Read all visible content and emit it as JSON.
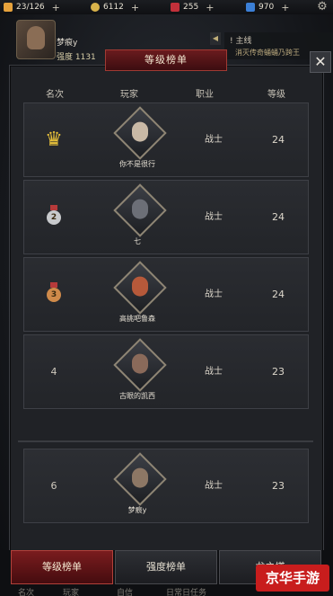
{
  "topbar": {
    "stamina": "23/126",
    "gold": "6112",
    "gems": "255",
    "crystals": "970"
  },
  "header": {
    "player_name": "梦痕y",
    "strength": "强度 1131"
  },
  "quest": {
    "title": "主线",
    "desc": "消灭传奇蛹蛹乃跨王"
  },
  "panel": {
    "title": "等级榜单",
    "columns": [
      "名次",
      "玩家",
      "职业",
      "等级"
    ]
  },
  "rows": [
    {
      "rank": "",
      "name": "你不是很行",
      "job": "战士",
      "level": "24",
      "color": "#c9b9a6"
    },
    {
      "rank": "2",
      "name": "七",
      "job": "战士",
      "level": "24",
      "color": "#6c6f77"
    },
    {
      "rank": "3",
      "name": "高挑吧鲁森",
      "job": "战士",
      "level": "24",
      "color": "#b6593a"
    },
    {
      "rank": "4",
      "name": "古眼的凯西",
      "job": "战士",
      "level": "23",
      "color": "#8a6a5a"
    }
  ],
  "self_row": {
    "rank": "6",
    "name": "梦痕y",
    "job": "战士",
    "level": "23",
    "color": "#8d7765"
  },
  "tabs": [
    "等级榜单",
    "强度榜单",
    "龙之塔"
  ],
  "tab_subs": [
    "名次",
    "玩家",
    "自信",
    "日常日任务"
  ],
  "watermark": "京华手游"
}
